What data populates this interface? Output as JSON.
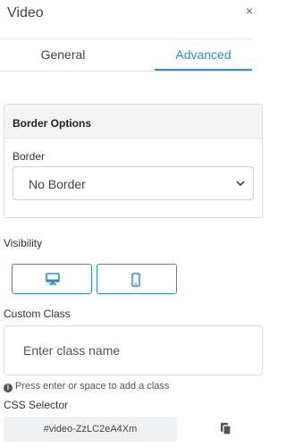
{
  "header": {
    "title": "Video",
    "close_glyph": "×"
  },
  "tabs": [
    {
      "label": "General",
      "active": false
    },
    {
      "label": "Advanced",
      "active": true
    }
  ],
  "border_options": {
    "title": "Border Options",
    "field_label": "Border",
    "selected_value": "No Border"
  },
  "visibility": {
    "label": "Visibility",
    "options": [
      {
        "icon": "desktop-icon"
      },
      {
        "icon": "mobile-icon"
      }
    ]
  },
  "custom_class": {
    "label": "Custom Class",
    "placeholder": "Enter class name",
    "value": "",
    "hint": "Press enter or space to add a class"
  },
  "css_selector": {
    "label": "CSS Selector",
    "value": "#video-ZzLC2eA4Xm"
  },
  "colors": {
    "accent": "#2f8fcb",
    "panel_bg": "#f4f4f4",
    "selector_bg": "#eef2f5"
  }
}
